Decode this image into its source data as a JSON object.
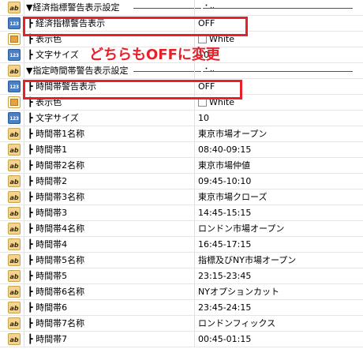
{
  "rows": [
    {
      "icon": "ab",
      "label": "▼経済指標警告表示設定",
      "kind": "group"
    },
    {
      "icon": "num",
      "label": "┣ 経済指標警告表示",
      "value": "OFF"
    },
    {
      "icon": "color",
      "label": "┣ 表示色",
      "value": "White",
      "swatch": true
    },
    {
      "icon": "num",
      "label": "┣ 文字サイズ",
      "value": "10"
    },
    {
      "icon": "ab",
      "label": "▼指定時間帯警告表示設定",
      "kind": "group"
    },
    {
      "icon": "num",
      "label": "┣ 時間帯警告表示",
      "value": "OFF"
    },
    {
      "icon": "color",
      "label": "┣ 表示色",
      "value": "White",
      "swatch": true
    },
    {
      "icon": "num",
      "label": "┣ 文字サイズ",
      "value": "10"
    },
    {
      "icon": "ab",
      "label": "┣ 時間帯1名称",
      "value": "東京市場オープン"
    },
    {
      "icon": "ab",
      "label": "┣ 時間帯1",
      "value": "08:40-09:15"
    },
    {
      "icon": "ab",
      "label": "┣ 時間帯2名称",
      "value": "東京市場仲値"
    },
    {
      "icon": "ab",
      "label": "┣ 時間帯2",
      "value": "09:45-10:10"
    },
    {
      "icon": "ab",
      "label": "┣ 時間帯3名称",
      "value": "東京市場クローズ"
    },
    {
      "icon": "ab",
      "label": "┣ 時間帯3",
      "value": "14:45-15:15"
    },
    {
      "icon": "ab",
      "label": "┣ 時間帯4名称",
      "value": "ロンドン市場オープン"
    },
    {
      "icon": "ab",
      "label": "┣ 時間帯4",
      "value": "16:45-17:15"
    },
    {
      "icon": "ab",
      "label": "┣ 時間帯5名称",
      "value": "指標及びNY市場オープン"
    },
    {
      "icon": "ab",
      "label": "┣ 時間帯5",
      "value": "23:15-23:45"
    },
    {
      "icon": "ab",
      "label": "┣ 時間帯6名称",
      "value": "NYオプションカット"
    },
    {
      "icon": "ab",
      "label": "┣ 時間帯6",
      "value": "23:45-24:15"
    },
    {
      "icon": "ab",
      "label": "┣ 時間帯7名称",
      "value": "ロンドンフィックス"
    },
    {
      "icon": "ab",
      "label": "┣ 時間帯7",
      "value": "00:45-01:15"
    }
  ],
  "group_suffix": "・..",
  "annotation": "どちらもOFFに変更",
  "colors": {
    "highlight": "#e8202a",
    "icon_text": "#f2d38f",
    "icon_number": "#4a7fc4"
  }
}
